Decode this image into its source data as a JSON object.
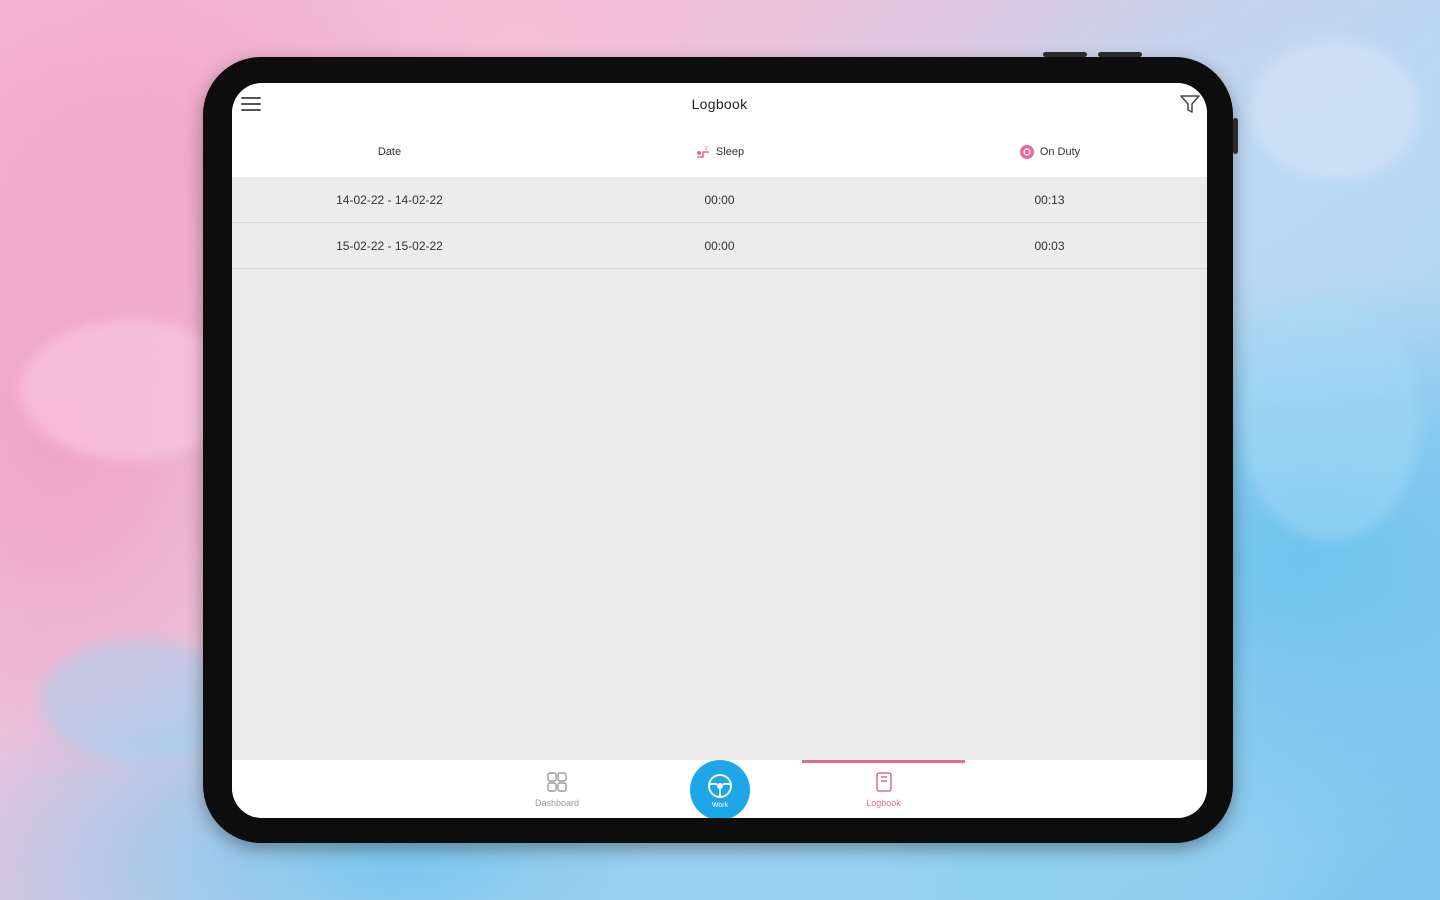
{
  "app": {
    "title": "Logbook"
  },
  "colors": {
    "accent_pink": "#e46a9c",
    "accent_blue": "#1ea7e6",
    "row_background": "#ececec"
  },
  "table": {
    "columns": [
      {
        "label": "Date",
        "icon": ""
      },
      {
        "label": "Sleep",
        "icon": "sleep-icon"
      },
      {
        "label": "On Duty",
        "icon": "on-duty-icon"
      }
    ],
    "rows": [
      {
        "date": "14-02-22 - 14-02-22",
        "sleep": "00:00",
        "on_duty": "00:13"
      },
      {
        "date": "15-02-22 - 15-02-22",
        "sleep": "00:00",
        "on_duty": "00:03"
      }
    ]
  },
  "bottom_nav": {
    "dashboard_label": "Dashboard",
    "center_label": "Work",
    "logbook_label": "Logbook",
    "active_tab": "Logbook"
  }
}
